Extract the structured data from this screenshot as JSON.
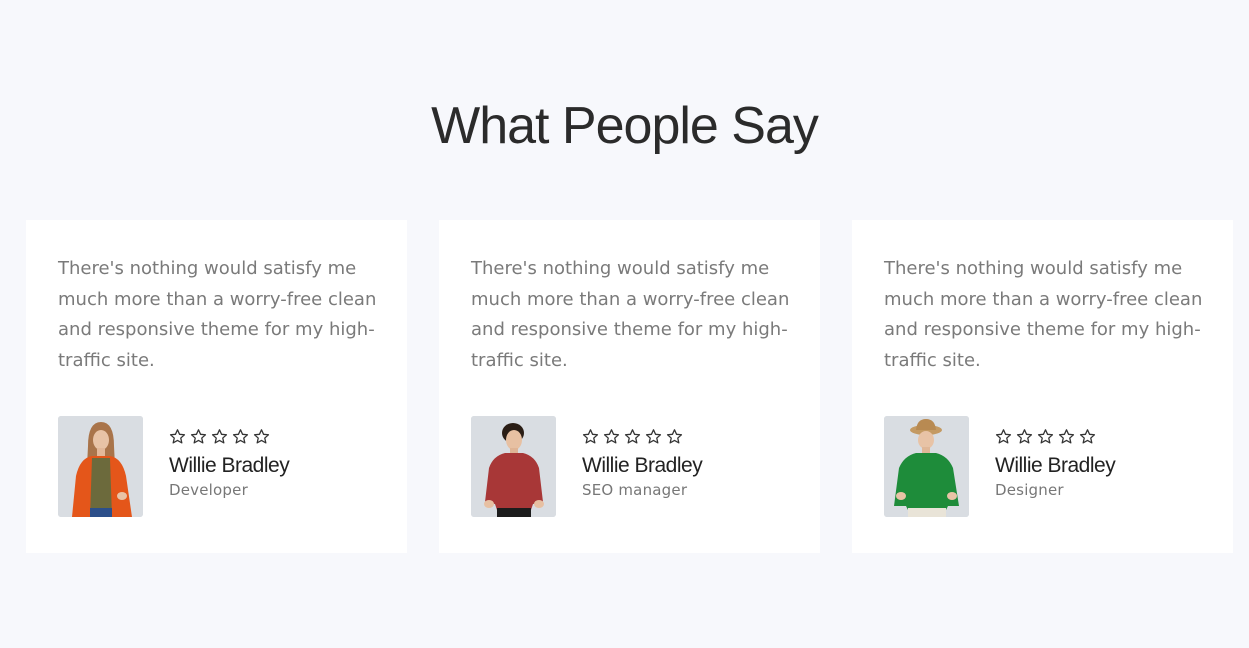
{
  "section": {
    "title": "What People Say"
  },
  "testimonials": [
    {
      "quote": "There's nothing would satisfy me much more than a worry-free clean and responsive theme for my high-traffic site.",
      "name": "Willie Bradley",
      "role": "Developer",
      "stars": 5,
      "rating_filled": 0,
      "avatar_icon": "woman-orange-jacket-photo"
    },
    {
      "quote": "There's nothing would satisfy me much more than a worry-free clean and responsive theme for my high-traffic site.",
      "name": "Willie Bradley",
      "role": "SEO manager",
      "stars": 5,
      "rating_filled": 0,
      "avatar_icon": "man-red-sweater-photo"
    },
    {
      "quote": "There's nothing would satisfy me much more than a worry-free clean and responsive theme for my high-traffic site.",
      "name": "Willie Bradley",
      "role": "Designer",
      "stars": 5,
      "rating_filled": 0,
      "avatar_icon": "woman-green-sweater-hat-photo"
    }
  ],
  "colors": {
    "background": "#f7f8fc",
    "card": "#ffffff",
    "title": "#2b2b2b",
    "quote_text": "#7a7a7a",
    "avatar_bg": "#d9dde2",
    "star_outline": "#333333"
  }
}
